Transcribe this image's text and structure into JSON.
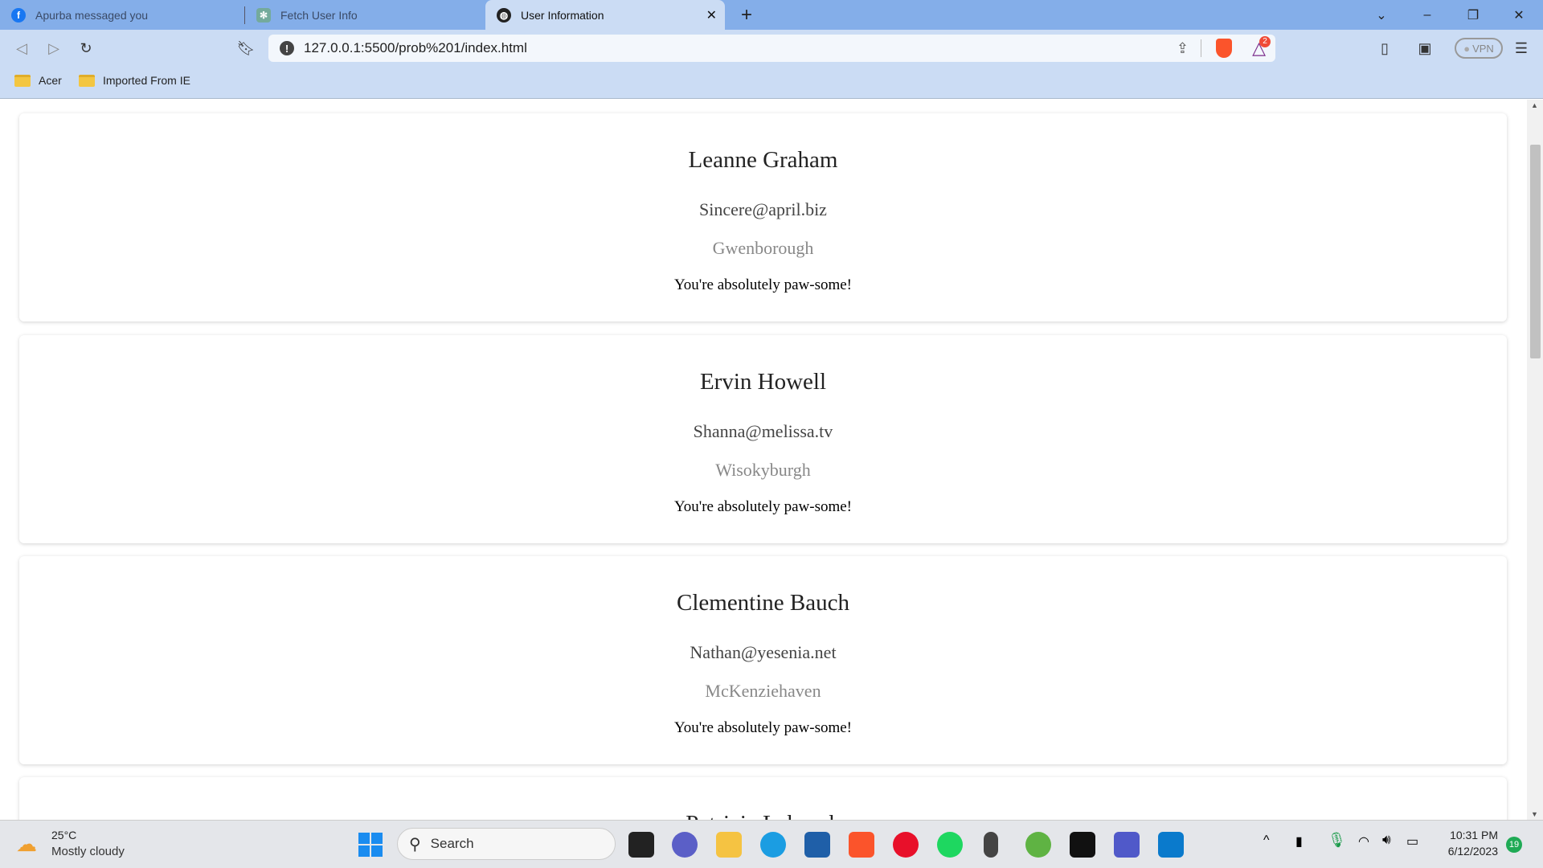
{
  "browser": {
    "tabs": [
      {
        "label": "Apurba messaged you",
        "icon": "facebook-icon",
        "active": false
      },
      {
        "label": "Fetch User Info",
        "icon": "chatgpt-icon",
        "active": false
      },
      {
        "label": "User Information",
        "icon": "globe-icon",
        "active": true
      }
    ],
    "url": "127.0.0.1:5500/prob%201/index.html",
    "vpn_label": "VPN",
    "rewards_badge": "2",
    "bookmarks": [
      {
        "label": "Acer"
      },
      {
        "label": "Imported From IE"
      }
    ]
  },
  "users": [
    {
      "name": "Leanne Graham",
      "email": "Sincere@april.biz",
      "city": "Gwenborough",
      "tagline": "You're absolutely paw-some!"
    },
    {
      "name": "Ervin Howell",
      "email": "Shanna@melissa.tv",
      "city": "Wisokyburgh",
      "tagline": "You're absolutely paw-some!"
    },
    {
      "name": "Clementine Bauch",
      "email": "Nathan@yesenia.net",
      "city": "McKenziehaven",
      "tagline": "You're absolutely paw-some!"
    },
    {
      "name": "Patricia Lebsack"
    }
  ],
  "taskbar": {
    "weather_temp": "25°C",
    "weather_desc": "Mostly cloudy",
    "search_label": "Search",
    "time": "10:31 PM",
    "date": "6/12/2023",
    "notification_count": "19"
  }
}
